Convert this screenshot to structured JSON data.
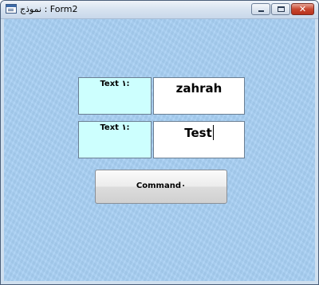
{
  "window": {
    "title": "نموذج : Form2",
    "close_glyph": "✕"
  },
  "form": {
    "rows": [
      {
        "label": "Text ١:",
        "value": "zahrah"
      },
      {
        "label": "Text ١:",
        "value": "Test"
      }
    ],
    "command_label": "Command٠"
  }
}
